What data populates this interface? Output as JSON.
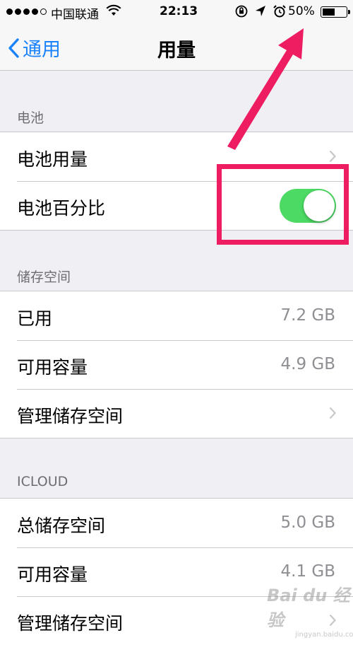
{
  "status_bar": {
    "carrier": "中国联通",
    "time": "22:13",
    "battery_percent": "50%",
    "battery_level": 0.5,
    "signal_bars": 4,
    "icons": [
      "rotation-lock-icon",
      "location-arrow-icon",
      "alarm-icon"
    ]
  },
  "nav": {
    "back_label": "通用",
    "title": "用量"
  },
  "sections": {
    "battery": {
      "header": "电池",
      "rows": [
        {
          "label": "电池用量",
          "accessory": "chevron"
        },
        {
          "label": "电池百分比",
          "accessory": "toggle",
          "toggle_on": true
        }
      ]
    },
    "storage": {
      "header": "储存空间",
      "rows": [
        {
          "label": "已用",
          "value": "7.2 GB"
        },
        {
          "label": "可用容量",
          "value": "4.9 GB"
        },
        {
          "label": "管理储存空间",
          "accessory": "chevron"
        }
      ]
    },
    "icloud": {
      "header": "ICLOUD",
      "rows": [
        {
          "label": "总储存空间",
          "value": "5.0 GB"
        },
        {
          "label": "可用容量",
          "value": "4.1 GB"
        },
        {
          "label": "管理储存空间",
          "accessory": "chevron"
        }
      ]
    }
  },
  "colors": {
    "accent": "#1a82fb",
    "toggle_on": "#4cd964",
    "annotation": "#ee1d62",
    "background": "#efeff4"
  },
  "watermark": {
    "logo": "Bai du 经验",
    "url": "jingyan.baidu.com"
  }
}
